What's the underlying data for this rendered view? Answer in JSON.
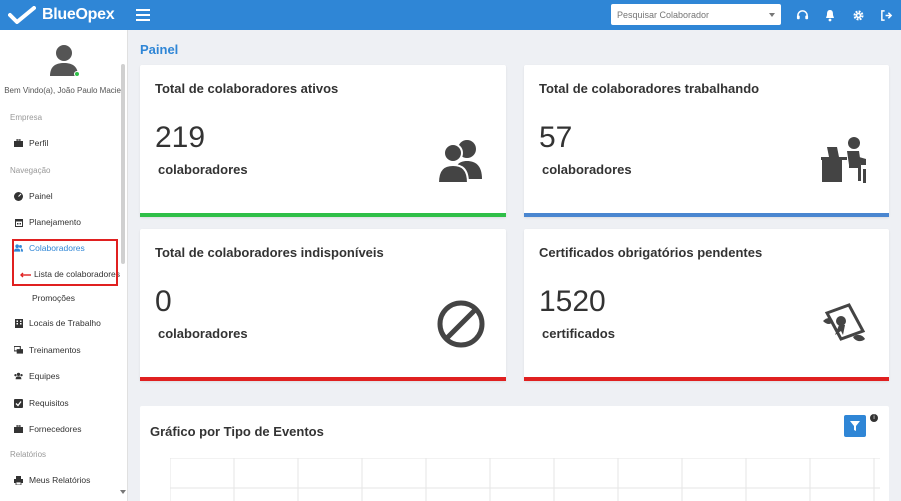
{
  "app": {
    "brand": "BlueOpex"
  },
  "header": {
    "search_placeholder": "Pesquisar Colaborador",
    "icons": [
      "headset-icon",
      "bell-icon",
      "gear-icon",
      "logout-icon"
    ]
  },
  "sidebar": {
    "welcome": "Bem Vindo(a), João Paulo Maciel",
    "sections": {
      "empresa": "Empresa",
      "navegacao": "Navegação",
      "relatorios": "Relatórios"
    },
    "items": {
      "perfil": "Perfil",
      "painel": "Painel",
      "planejamento": "Planejamento",
      "colaboradores": "Colaboradores",
      "lista": "Lista de colaboradores",
      "promocoes": "Promoções",
      "locais": "Locais de Trabalho",
      "treinamentos": "Treinamentos",
      "equipes": "Equipes",
      "requisitos": "Requisitos",
      "fornecedores": "Fornecedores",
      "relatorios": "Meus Relatórios"
    }
  },
  "main": {
    "page_title": "Painel",
    "cards": [
      {
        "title": "Total de colaboradores ativos",
        "value": "219",
        "unit": "colaboradores",
        "icon": "users-icon",
        "color": "#2fbf48"
      },
      {
        "title": "Total de colaboradores trabalhando",
        "value": "57",
        "unit": "colaboradores",
        "icon": "worker-desk-icon",
        "color": "#4a86d0"
      },
      {
        "title": "Total de colaboradores indisponíveis",
        "value": "0",
        "unit": "colaboradores",
        "icon": "ban-icon",
        "color": "#e02020"
      },
      {
        "title": "Certificados obrigatórios pendentes",
        "value": "1520",
        "unit": "certificados",
        "icon": "certificate-icon",
        "color": "#e02020"
      }
    ],
    "chart": {
      "title": "Gráfico por Tipo de Eventos"
    }
  },
  "colors": {
    "primary": "#2f86d6",
    "green": "#2fbf48",
    "red": "#e02020"
  }
}
